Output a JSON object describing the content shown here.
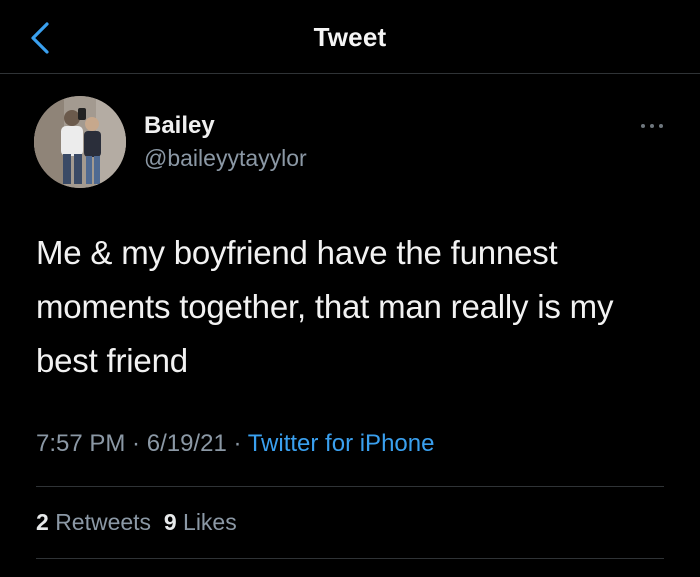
{
  "header": {
    "title": "Tweet",
    "back_icon": "chevron-left-icon"
  },
  "author": {
    "name": "Bailey",
    "handle": "@baileyytayylor"
  },
  "more_icon": "ellipsis-icon",
  "tweet": {
    "text": "Me & my boyfriend have the funnest moments together, that man really is my best friend"
  },
  "meta": {
    "time": "7:57 PM",
    "date": "6/19/21",
    "separator": " · ",
    "source": "Twitter for iPhone"
  },
  "stats": {
    "retweets_count": "2",
    "retweets_label": "Retweets",
    "likes_count": "9",
    "likes_label": "Likes"
  },
  "colors": {
    "background": "#000000",
    "accent": "#3aa0ef",
    "secondary_text": "#8b98a5",
    "divider": "#2f3336"
  }
}
